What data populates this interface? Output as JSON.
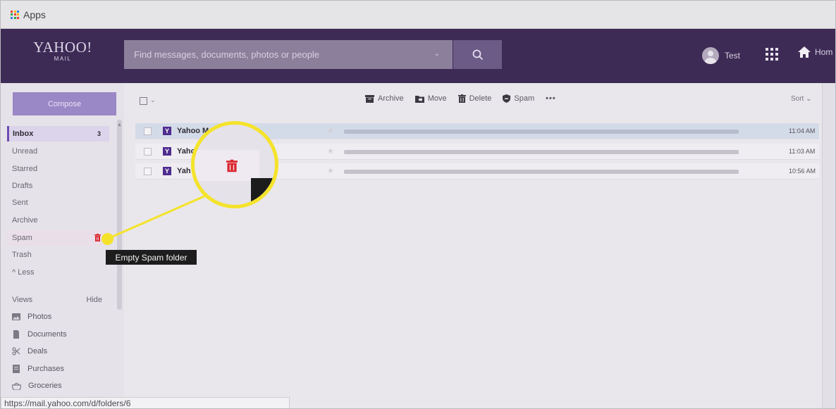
{
  "bookmarks": {
    "apps_label": "Apps"
  },
  "header": {
    "logo_line1": "YAHOO!",
    "logo_line2": "MAIL",
    "search_placeholder": "Find messages, documents, photos or people",
    "user_name": "Test",
    "home_label": "Hom"
  },
  "sidebar": {
    "compose_label": "Compose",
    "folders": [
      {
        "label": "Inbox",
        "count": "3"
      },
      {
        "label": "Unread"
      },
      {
        "label": "Starred"
      },
      {
        "label": "Drafts"
      },
      {
        "label": "Sent"
      },
      {
        "label": "Archive"
      },
      {
        "label": "Spam"
      },
      {
        "label": "Trash"
      },
      {
        "label": "^ Less"
      }
    ],
    "views_label": "Views",
    "hide_label": "Hide",
    "views": [
      {
        "label": "Photos",
        "icon": "photos-icon"
      },
      {
        "label": "Documents",
        "icon": "document-icon"
      },
      {
        "label": "Deals",
        "icon": "scissors-icon"
      },
      {
        "label": "Purchases",
        "icon": "receipt-icon"
      },
      {
        "label": "Groceries",
        "icon": "basket-icon"
      }
    ]
  },
  "toolbar": {
    "archive_label": "Archive",
    "move_label": "Move",
    "delete_label": "Delete",
    "spam_label": "Spam",
    "more_label": "•••",
    "sort_label": "Sort ⌄"
  },
  "messages": [
    {
      "sender": "Yahoo M",
      "time": "11:04 AM",
      "selected": true
    },
    {
      "sender": "Yaho",
      "time": "11:03 AM",
      "selected": false
    },
    {
      "sender": "Yah",
      "time": "10:56 AM",
      "selected": false
    }
  ],
  "tooltip": {
    "text": "Empty Spam folder"
  },
  "statusbar": {
    "url": "https://mail.yahoo.com/d/folders/6"
  },
  "colors": {
    "header_bg": "#3d2a55",
    "accent": "#6d4ab1",
    "highlight": "#f4e32a",
    "trash_red": "#d9262d"
  }
}
